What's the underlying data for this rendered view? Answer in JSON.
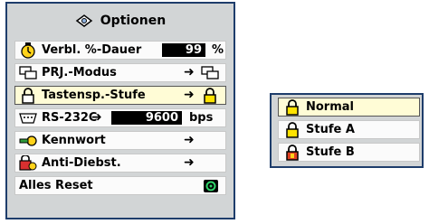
{
  "menu": {
    "title": "Optionen",
    "items": [
      {
        "label": "Verbl. %-Dauer",
        "value": "99",
        "unit": "%",
        "icon": "timer-icon"
      },
      {
        "label": "PRJ.-Modus",
        "arrow": "➜",
        "icon": "projector-mode-icon"
      },
      {
        "label": "Tastensp.-Stufe",
        "arrow": "➜",
        "icon": "lock-icon"
      },
      {
        "label": "RS-232C",
        "arrow": "➜",
        "value": "9600",
        "unit": "bps",
        "icon": "rs232c-port-icon"
      },
      {
        "label": "Kennwort",
        "arrow": "➜",
        "icon": "key-icon"
      },
      {
        "label": "Anti-Diebst.",
        "arrow": "➜",
        "icon": "anti-theft-icon"
      },
      {
        "label": "Alles Reset",
        "icon": "reset-icon"
      }
    ]
  },
  "submenu": {
    "items": [
      {
        "label": "Normal",
        "icon": "lock-icon"
      },
      {
        "label": "Stufe A",
        "icon": "lock-icon"
      },
      {
        "label": "Stufe B",
        "icon": "lock-red-icon"
      }
    ]
  }
}
